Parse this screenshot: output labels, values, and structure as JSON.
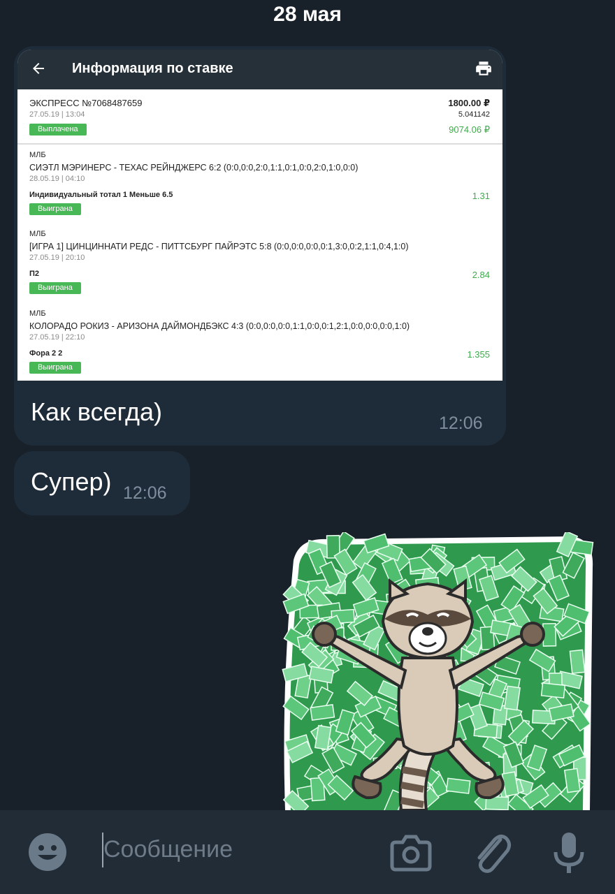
{
  "chat": {
    "date": "28 мая",
    "messages": [
      {
        "text": "Как всегда)",
        "time": "12:06"
      },
      {
        "text": "Супер)",
        "time": "12:06"
      }
    ]
  },
  "bet_screen": {
    "header_title": "Информация по ставке",
    "summary": {
      "title": "ЭКСПРЕСС №7068487659",
      "datetime": "27.05.19 | 13:04",
      "status": "Выплачена",
      "stake": "1800.00 ₽",
      "coef": "5.041142",
      "payout": "9074.06 ₽"
    },
    "events": [
      {
        "league": "МЛБ",
        "match": "СИЭТЛ МЭРИНЕРС - ТЕХАС РЕЙНДЖЕРС 6:2 (0:0,0:0,2:0,1:1,0:1,0:0,2:0,1:0,0:0)",
        "datetime": "28.05.19 | 04:10",
        "bet": "Индивидуальный тотал 1 Меньше 6.5",
        "odds": "1.31",
        "status": "Выиграна"
      },
      {
        "league": "МЛБ",
        "match": "[ИГРА 1] ЦИНЦИННАТИ РЕДС - ПИТТСБУРГ ПАЙРЭТС 5:8 (0:0,0:0,0:0,0:1,3:0,0:2,1:1,0:4,1:0)",
        "datetime": "27.05.19 | 20:10",
        "bet": "П2",
        "odds": "2.84",
        "status": "Выиграна"
      },
      {
        "league": "МЛБ",
        "match": "КОЛОРАДО РОКИЗ - АРИЗОНА ДАЙМОНДБЭКС 4:3 (0:0,0:0,0:0,1:1,0:0,0:1,2:1,0:0,0:0,0:0,1:0)",
        "datetime": "27.05.19 | 22:10",
        "bet": "Фора 2 2",
        "odds": "1.355",
        "status": "Выиграна"
      }
    ]
  },
  "input": {
    "placeholder": "Сообщение"
  },
  "icons": {
    "emoji": "emoji-icon",
    "camera": "camera-icon",
    "attach": "paperclip-icon",
    "mic": "microphone-icon",
    "back": "arrow-left-icon",
    "print": "printer-icon"
  },
  "colors": {
    "background": "#182029",
    "bubble": "#1e2c3a",
    "green_badge": "#48b755",
    "green_text": "#3dab4b"
  }
}
